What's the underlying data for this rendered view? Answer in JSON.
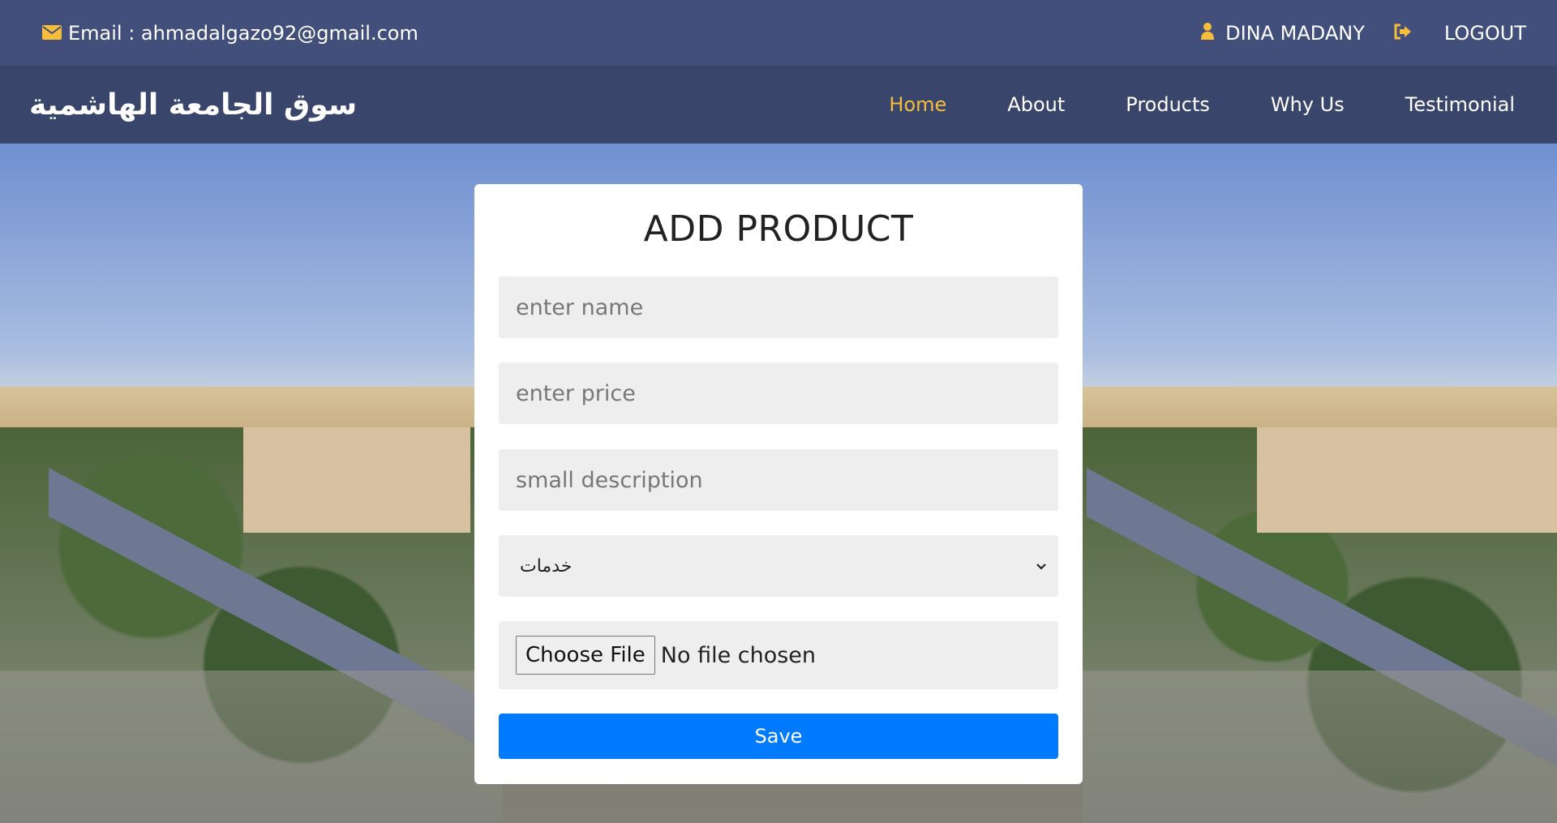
{
  "topbar": {
    "email_text": "Email : ahmadalgazo92@gmail.com",
    "username": "DINA MADANY",
    "logout_label": "LOGOUT",
    "icons": {
      "email": "envelope-icon",
      "user": "user-icon",
      "logout": "sign-out-icon"
    },
    "icon_color": "#f6bd3a"
  },
  "navbar": {
    "brand": "سوق الجامعة الهاشمية",
    "links": [
      {
        "label": "Home",
        "active": true
      },
      {
        "label": "About",
        "active": false
      },
      {
        "label": "Products",
        "active": false
      },
      {
        "label": "Why Us",
        "active": false
      },
      {
        "label": "Testimonial",
        "active": false
      }
    ],
    "active_color": "#f6bd3a"
  },
  "form": {
    "title": "ADD PRODUCT",
    "name_placeholder": "enter name",
    "price_placeholder": "enter price",
    "description_placeholder": "small description",
    "category_selected": "خدمات",
    "file_button_label": "Choose File",
    "file_status": "No file chosen",
    "save_label": "Save",
    "save_color": "#007bff"
  }
}
